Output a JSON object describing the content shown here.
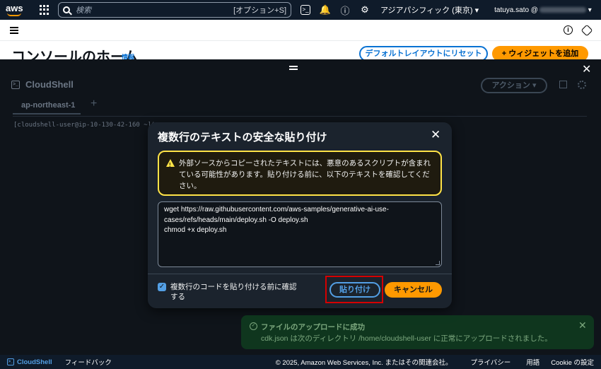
{
  "topnav": {
    "logo": "aws",
    "search_placeholder": "検索",
    "search_shortcut": "[オプション+S]",
    "region": "アジアパシフィック (東京)",
    "user": "tatuya.sato @",
    "icons": [
      "grid-icon",
      "cloudshell-icon",
      "bell-icon",
      "help-icon",
      "settings-icon"
    ]
  },
  "console": {
    "title": "コンソールのホーム",
    "info": "情報",
    "reset_button": "デフォルトレイアウトにリセット",
    "widget_button": "ウィジェットを追加"
  },
  "cloudshell": {
    "title": "CloudShell",
    "action_button": "アクション",
    "tab": "ap-northeast-1",
    "prompt": "[cloudshell-user@ip-10-130-42-160 ~]$"
  },
  "modal": {
    "title": "複数行のテキストの安全な貼り付け",
    "warning": "外部ソースからコピーされたテキストには、悪意のあるスクリプトが含まれている可能性があります。貼り付ける前に、以下のテキストを確認してください。",
    "code_lines": [
      "wget https://raw.githubusercontent.com/aws-samples/generative-ai-use-",
      "cases/refs/heads/main/deploy.sh -O deploy.sh",
      "chmod +x deploy.sh"
    ],
    "checkbox_label": "複数行のコードを貼り付ける前に確認する",
    "checkbox_checked": true,
    "paste_button": "貼り付け",
    "cancel_button": "キャンセル"
  },
  "toast": {
    "title": "ファイルのアップロードに成功",
    "message": "cdk.json は次のディレクトリ /home/cloudshell-user に正常にアップロードされました。"
  },
  "footer": {
    "cloudshell": "CloudShell",
    "feedback": "フィードバック",
    "copyright": "© 2025, Amazon Web Services, Inc. またはその関連会社。",
    "privacy": "プライバシー",
    "terms": "用語",
    "cookie": "Cookie の設定"
  },
  "colors": {
    "accent_orange": "#ff9900",
    "link_blue": "#539fe5",
    "warning_yellow": "#ffe347",
    "success_green": "#0f3d1f",
    "highlight_red": "#d50000"
  }
}
